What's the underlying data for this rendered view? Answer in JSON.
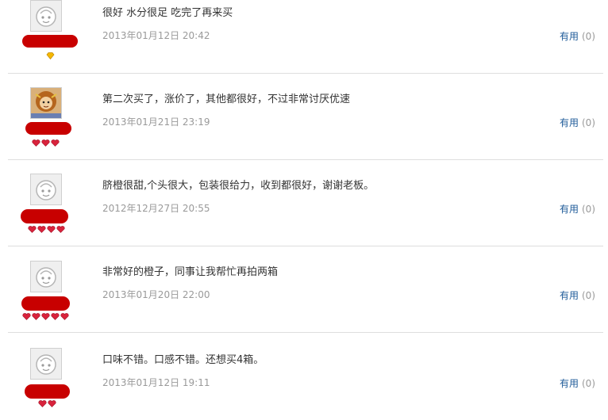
{
  "reviews": [
    {
      "content": "很好 水分很足 吃完了再来买",
      "date": "2013年01月12日 20:42",
      "useful_label": "有用",
      "useful_count": "(0)",
      "avatar": "default-face-avatar",
      "level_badges": 1,
      "badge_type": "yellow-diamond"
    },
    {
      "content": "第二次买了，涨价了，其他都很好，不过非常讨厌优速",
      "date": "2013年01月21日 23:19",
      "useful_label": "有用",
      "useful_count": "(0)",
      "avatar": "custom-photo-avatar",
      "level_badges": 3,
      "badge_type": "red-heart"
    },
    {
      "content": "脐橙很甜,个头很大，包装很给力，收到都很好，谢谢老板。",
      "date": "2012年12月27日 20:55",
      "useful_label": "有用",
      "useful_count": "(0)",
      "avatar": "default-face-avatar",
      "level_badges": 4,
      "badge_type": "red-heart"
    },
    {
      "content": "非常好的橙子，同事让我帮忙再拍两箱",
      "date": "2013年01月20日 22:00",
      "useful_label": "有用",
      "useful_count": "(0)",
      "avatar": "default-face-avatar",
      "level_badges": 5,
      "badge_type": "red-heart"
    },
    {
      "content": "口味不错。口感不错。还想买4箱。",
      "date": "2013年01月12日 19:11",
      "useful_label": "有用",
      "useful_count": "(0)",
      "avatar": "default-face-avatar",
      "level_badges": 2,
      "badge_type": "red-heart"
    }
  ],
  "colors": {
    "useful_label": "#1f5b99",
    "date_text": "#9a9a9a",
    "redaction": "#c80000",
    "heart": "#d9233c",
    "divider": "#dedede"
  }
}
